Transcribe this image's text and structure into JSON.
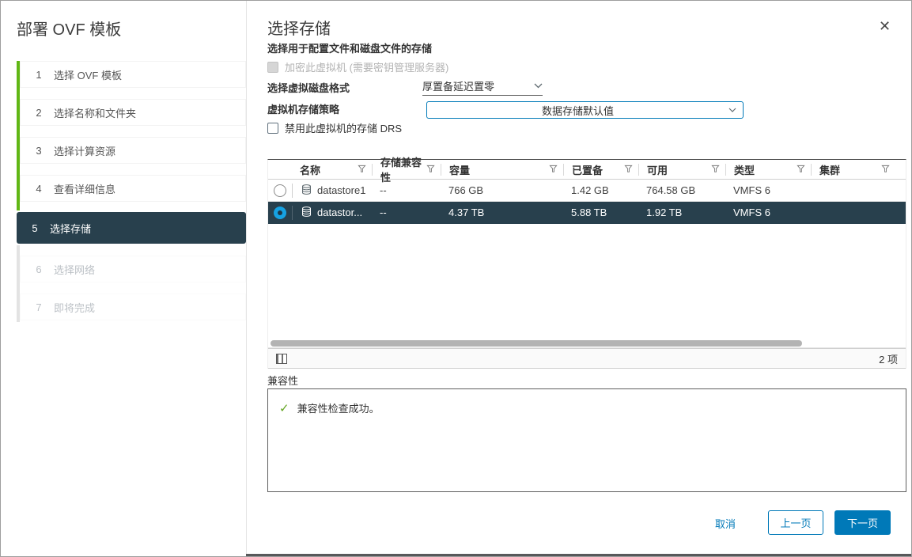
{
  "dialog": {
    "title": "部署 OVF 模板",
    "close_glyph": "✕"
  },
  "sidebar": {
    "steps": [
      {
        "num": "1",
        "label": "选择 OVF 模板",
        "state": "done"
      },
      {
        "num": "2",
        "label": "选择名称和文件夹",
        "state": "done"
      },
      {
        "num": "3",
        "label": "选择计算资源",
        "state": "done"
      },
      {
        "num": "4",
        "label": "查看详细信息",
        "state": "done"
      },
      {
        "num": "5",
        "label": "选择存储",
        "state": "active"
      },
      {
        "num": "6",
        "label": "选择网络",
        "state": "disabled"
      },
      {
        "num": "7",
        "label": "即将完成",
        "state": "disabled"
      }
    ]
  },
  "main": {
    "title": "选择存储",
    "subtitle": "选择用于配置文件和磁盘文件的存储",
    "encrypt_checkbox": {
      "label": "加密此虚拟机 (需要密钥管理服务器)",
      "checked": false,
      "disabled": true
    },
    "disk_format": {
      "label": "选择虚拟磁盘格式",
      "value": "厚置备延迟置零"
    },
    "storage_policy": {
      "label": "虚拟机存储策略",
      "value": "数据存储默认值"
    },
    "drs_checkbox": {
      "label": "禁用此虚拟机的存储 DRS",
      "checked": false
    }
  },
  "storage_table": {
    "columns": [
      "名称",
      "存储兼容性",
      "容量",
      "已置备",
      "可用",
      "类型",
      "集群"
    ],
    "rows": [
      {
        "name": "datastore1",
        "compat": "--",
        "capacity": "766 GB",
        "provisioned": "1.42 GB",
        "free": "764.58 GB",
        "type": "VMFS 6",
        "cluster": "",
        "selected": false
      },
      {
        "name": "datastor...",
        "compat": "--",
        "capacity": "4.37 TB",
        "provisioned": "5.88 TB",
        "free": "1.92 TB",
        "type": "VMFS 6",
        "cluster": "",
        "selected": true
      }
    ],
    "item_count": "2 项"
  },
  "compatibility": {
    "label": "兼容性",
    "check_glyph": "✓",
    "message": "兼容性检查成功。"
  },
  "footer": {
    "cancel": "取消",
    "back": "上一页",
    "next": "下一页"
  },
  "colors": {
    "accent_blue": "#0079b8",
    "step_done_green": "#61b715",
    "selected_row_bg": "#28404d",
    "success_green": "#62a420",
    "radio_checked_blue": "#16a2e2"
  }
}
